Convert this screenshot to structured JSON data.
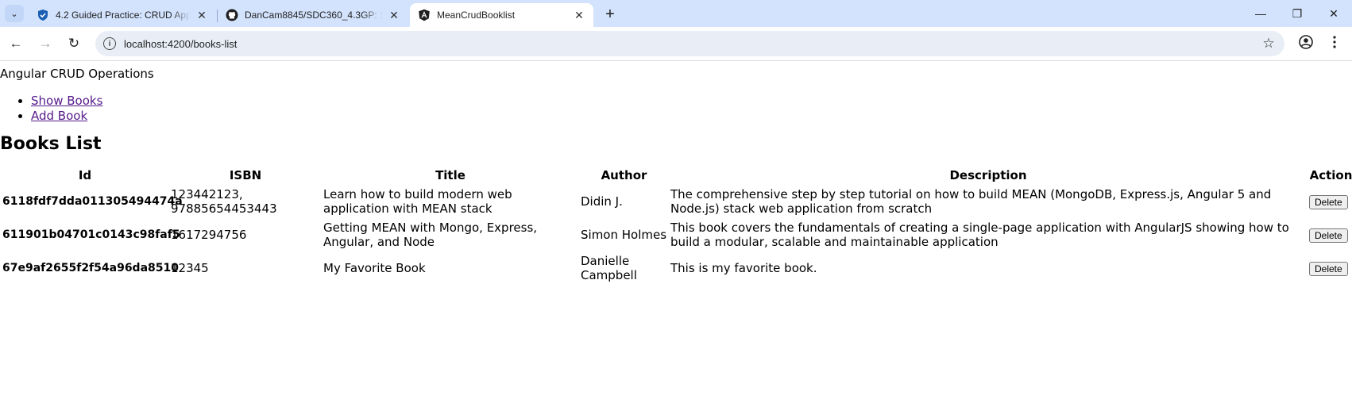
{
  "browser": {
    "tabs": [
      {
        "title": "4.2 Guided Practice: CRUD Appl",
        "favicon": "shield-check-icon",
        "active": false
      },
      {
        "title": "DanCam8845/SDC360_4.3GP: SD",
        "favicon": "github-icon",
        "active": false
      },
      {
        "title": "MeanCrudBooklist",
        "favicon": "angular-icon",
        "active": true
      }
    ],
    "address": "localhost:4200/books-list"
  },
  "app": {
    "title": "Angular CRUD Operations",
    "nav": [
      "Show Books",
      "Add Book"
    ],
    "heading": "Books List"
  },
  "table": {
    "headers": [
      "Id",
      "ISBN",
      "Title",
      "Author",
      "Description",
      "Action"
    ],
    "rows": [
      {
        "id": "6118fdf7dda011305494474a",
        "isbn": "123442123, 97885654453443",
        "title": "Learn how to build modern web application with MEAN stack",
        "author": "Didin J.",
        "description": "The comprehensive step by step tutorial on how to build MEAN (MongoDB, Express.js, Angular 5 and Node.js) stack web application from scratch",
        "action": "Delete"
      },
      {
        "id": "611901b04701c0143c98faf5",
        "isbn": "1617294756",
        "title": "Getting MEAN with Mongo, Express, Angular, and Node",
        "author": "Simon Holmes",
        "description": "This book covers the fundamentals of creating a single-page application with AngularJS showing how to build a modular, scalable and maintainable application",
        "action": "Delete"
      },
      {
        "id": "67e9af2655f2f54a96da8510",
        "isbn": "12345",
        "title": "My Favorite Book",
        "author": "Danielle Campbell",
        "description": "This is my favorite book.",
        "action": "Delete"
      }
    ]
  }
}
